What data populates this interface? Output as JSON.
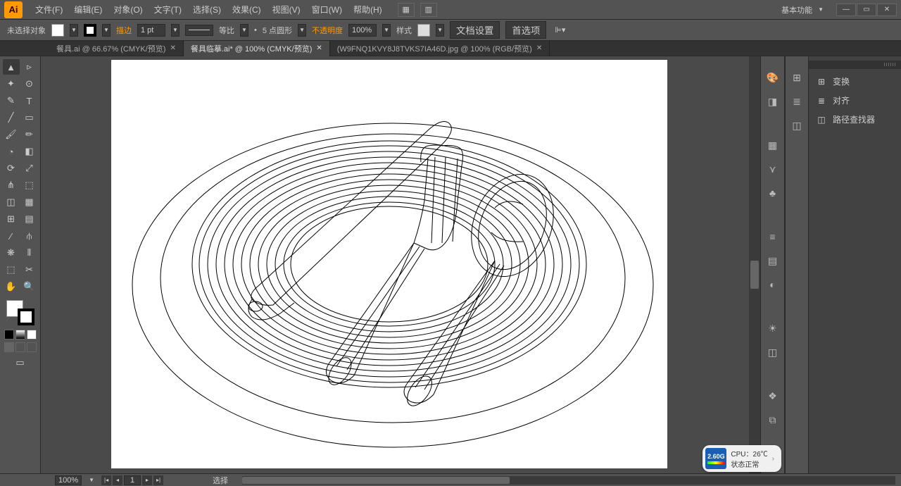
{
  "app": {
    "logo": "Ai",
    "workspace": "基本功能"
  },
  "menu": [
    "文件(F)",
    "编辑(E)",
    "对象(O)",
    "文字(T)",
    "选择(S)",
    "效果(C)",
    "视图(V)",
    "窗口(W)",
    "帮助(H)"
  ],
  "options": {
    "selection": "未选择对象",
    "stroke_label": "描边",
    "stroke_weight": "1 pt",
    "profile_label": "等比",
    "brush_label": "5 点圆形",
    "opacity_label": "不透明度",
    "opacity_value": "100%",
    "style_label": "样式",
    "doc_setup": "文档设置",
    "prefs": "首选项"
  },
  "tabs": [
    {
      "label": "餐具.ai @ 66.67% (CMYK/预览)",
      "active": false
    },
    {
      "label": "餐具临摹.ai* @ 100% (CMYK/预览)",
      "active": true
    },
    {
      "label": "(W9FNQ1KVY8J8TVKS7IA46D.jpg @ 100% (RGB/预览)",
      "active": false
    }
  ],
  "panels": [
    "变换",
    "对齐",
    "路径查找器"
  ],
  "status": {
    "zoom": "100%",
    "tool": "选择"
  },
  "cpu": {
    "ghz": "2.60G",
    "temp": "CPU：26℃",
    "state": "状态正常"
  }
}
